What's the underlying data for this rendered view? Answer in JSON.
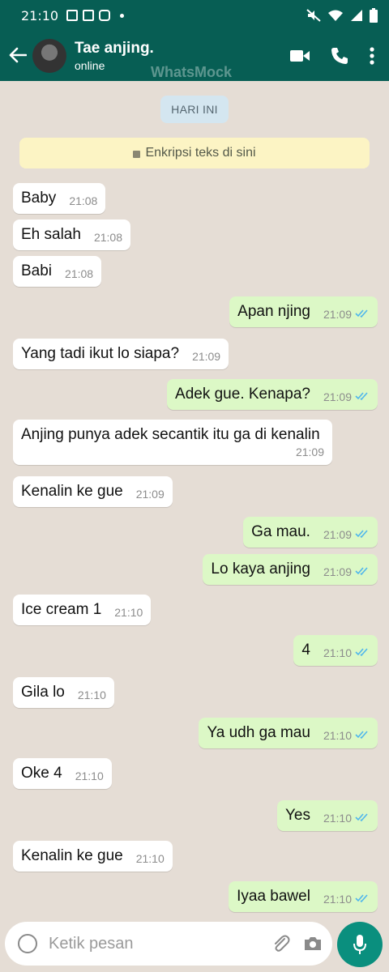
{
  "status_bar": {
    "time": "21:10"
  },
  "header": {
    "contact_name": "Tae anjing.",
    "contact_status": "online",
    "watermark": "WhatsMock"
  },
  "chat": {
    "day_label": "HARI INI",
    "encryption_notice": "Enkripsi teks di sini",
    "messages": [
      {
        "dir": "in",
        "text": "Baby",
        "time": "21:08"
      },
      {
        "dir": "in",
        "text": "Eh salah",
        "time": "21:08"
      },
      {
        "dir": "in",
        "text": "Babi",
        "time": "21:08"
      },
      {
        "dir": "out",
        "text": "Apan njing",
        "time": "21:09"
      },
      {
        "dir": "in",
        "text": "Yang tadi ikut lo siapa?",
        "time": "21:09"
      },
      {
        "dir": "out",
        "text": "Adek gue. Kenapa?",
        "time": "21:09"
      },
      {
        "dir": "in",
        "text": "Anjing punya adek secantik itu ga di kenalin",
        "time": "21:09"
      },
      {
        "dir": "in",
        "text": "Kenalin ke gue",
        "time": "21:09"
      },
      {
        "dir": "out",
        "text": "Ga mau.",
        "time": "21:09"
      },
      {
        "dir": "out",
        "text": "Lo kaya anjing",
        "time": "21:09"
      },
      {
        "dir": "in",
        "text": "Ice cream 1",
        "time": "21:10"
      },
      {
        "dir": "out",
        "text": "4",
        "time": "21:10"
      },
      {
        "dir": "in",
        "text": "Gila lo",
        "time": "21:10"
      },
      {
        "dir": "out",
        "text": "Ya udh ga mau",
        "time": "21:10"
      },
      {
        "dir": "in",
        "text": "Oke 4",
        "time": "21:10"
      },
      {
        "dir": "out",
        "text": "Yes",
        "time": "21:10"
      },
      {
        "dir": "in",
        "text": "Kenalin ke gue",
        "time": "21:10"
      },
      {
        "dir": "out",
        "text": "Iyaa bawel",
        "time": "21:10"
      }
    ]
  },
  "input": {
    "placeholder": "Ketik pesan"
  },
  "icons": {
    "back": "arrow-left-icon",
    "video": "video-call-icon",
    "call": "phone-icon",
    "menu": "more-vert-icon",
    "emoji": "emoji-icon",
    "attach": "paperclip-icon",
    "camera": "camera-icon",
    "mic": "mic-icon",
    "lock": "lock-icon",
    "read": "double-check-icon"
  },
  "colors": {
    "header": "#075e54",
    "chat_bg": "#e5ddd5",
    "incoming": "#ffffff",
    "outgoing": "#dcf8c6",
    "read_tick": "#4fb6ec",
    "mic_button": "#0a8f7e"
  }
}
